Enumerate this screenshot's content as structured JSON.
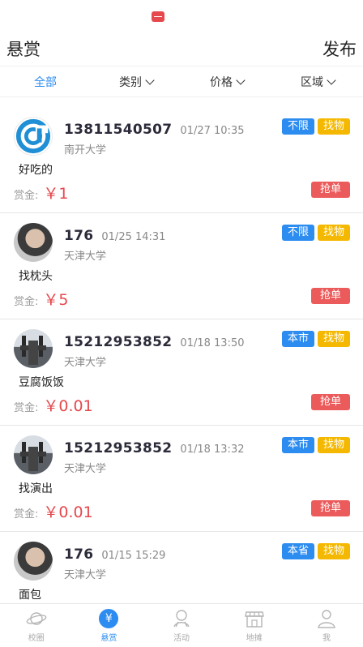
{
  "header": {
    "title": "悬赏",
    "publish_label": "发布"
  },
  "filters": [
    {
      "label": "全部",
      "active": true,
      "dropdown": false
    },
    {
      "label": "类别",
      "active": false,
      "dropdown": true
    },
    {
      "label": "价格",
      "active": false,
      "dropdown": true
    },
    {
      "label": "区域",
      "active": false,
      "dropdown": true
    }
  ],
  "reward_label": "赏金:",
  "grab_label": "抢单",
  "posts": [
    {
      "avatar": "logo-avatar",
      "user": "13811540507",
      "time": "01/27 10:35",
      "school": "南开大学",
      "scope": "不限",
      "kind": "找物",
      "desc": "好吃的",
      "amount": "￥1"
    },
    {
      "avatar": "person-avatar",
      "user": "176",
      "time": "01/25 14:31",
      "school": "天津大学",
      "scope": "不限",
      "kind": "找物",
      "desc": "找枕头",
      "amount": "￥5"
    },
    {
      "avatar": "car-avatar",
      "user": "15212953852",
      "time": "01/18 13:50",
      "school": "天津大学",
      "scope": "本市",
      "kind": "找物",
      "desc": "豆腐饭饭",
      "amount": "￥0.01"
    },
    {
      "avatar": "car-avatar",
      "user": "15212953852",
      "time": "01/18 13:32",
      "school": "天津大学",
      "scope": "本市",
      "kind": "找物",
      "desc": "找演出",
      "amount": "￥0.01"
    },
    {
      "avatar": "person-avatar",
      "user": "176",
      "time": "01/15 15:29",
      "school": "天津大学",
      "scope": "本省",
      "kind": "找物",
      "desc": "面包",
      "amount": ""
    }
  ],
  "bottom_nav": [
    {
      "label": "校圈",
      "icon": "planet-icon",
      "active": false
    },
    {
      "label": "悬赏",
      "icon": "yen-icon",
      "active": true
    },
    {
      "label": "活动",
      "icon": "activity-icon",
      "active": false
    },
    {
      "label": "地摊",
      "icon": "stall-icon",
      "active": false
    },
    {
      "label": "我",
      "icon": "user-icon",
      "active": false
    }
  ],
  "colors": {
    "accent": "#2d8cf0",
    "tag_kind": "#f5b800",
    "reward": "#e5484d",
    "grab_button": "#ec5b5b"
  }
}
